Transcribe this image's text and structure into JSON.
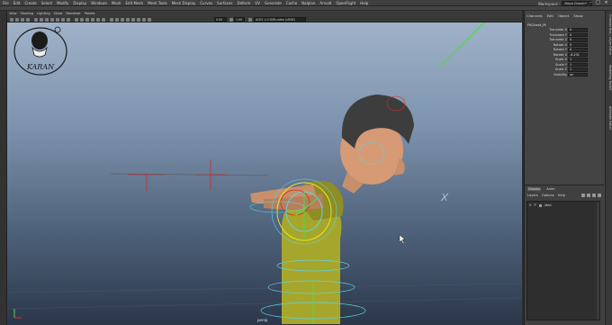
{
  "menubar": {
    "items": [
      "File",
      "Edit",
      "Create",
      "Select",
      "Modify",
      "Display",
      "Windows",
      "Mesh",
      "Edit Mesh",
      "Mesh Tools",
      "Mesh Display",
      "Curves",
      "Surfaces",
      "Deform",
      "UV",
      "Generate",
      "Cache",
      "Nalplan",
      "Arnold",
      "OpenFlight",
      "Help"
    ],
    "workspace_label": "Workspace :",
    "workspace_value": "Maya Classic*"
  },
  "viewport_menu": {
    "items": [
      "View",
      "Shading",
      "Lighting",
      "Show",
      "Renderer",
      "Panels"
    ]
  },
  "viewport_toolbar": {
    "field_1": "0.00",
    "field_2": "1.00",
    "colorspace": "ACES 1.0 SDR-video (sRGB)"
  },
  "viewport": {
    "camera_label": "persp",
    "logo_text": "KARAN"
  },
  "channel_box": {
    "tabs": [
      "Channels",
      "Edit",
      "Object",
      "Show"
    ],
    "object_name": "FKChest_M",
    "attributes": [
      {
        "name": "Translate X",
        "value": "0"
      },
      {
        "name": "Translate Y",
        "value": "0"
      },
      {
        "name": "Translate Z",
        "value": "0"
      },
      {
        "name": "Rotate X",
        "value": "0"
      },
      {
        "name": "Rotate Y",
        "value": "0"
      },
      {
        "name": "Rotate Z",
        "value": "-6.231"
      },
      {
        "name": "Scale X",
        "value": "1"
      },
      {
        "name": "Scale Y",
        "value": "1"
      },
      {
        "name": "Scale Z",
        "value": "1"
      },
      {
        "name": "Visibility",
        "value": "on"
      }
    ]
  },
  "layer_editor": {
    "tabs": [
      "Display",
      "Anim"
    ],
    "menu": [
      "Layers",
      "Options",
      "Help"
    ],
    "row": {
      "v": "V",
      "p": "P",
      "label": "/dea"
    }
  },
  "side_tabs": [
    "Channel Box / Layer Editor",
    "Modelling Toolkit",
    "Attribute Editor"
  ],
  "colors": {
    "nurbs_green": "#52d84a",
    "ctrl_red": "#e02424",
    "ctrl_yellow": "#e6e61e",
    "ctrl_cyan": "#5ad6e6",
    "shirt": "#a7a62c"
  }
}
